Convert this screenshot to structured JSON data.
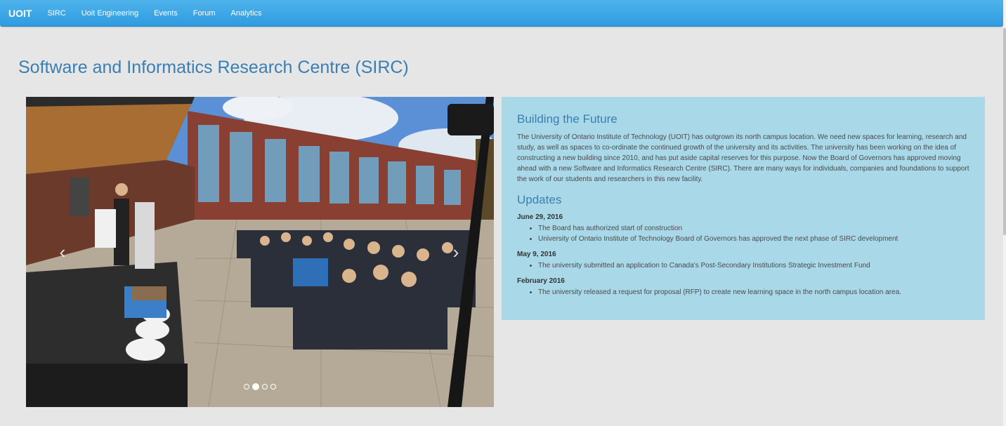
{
  "navbar": {
    "brand": "UOIT",
    "links": [
      "SIRC",
      "Uoit Engineering",
      "Events",
      "Forum",
      "Analytics"
    ]
  },
  "page": {
    "title": "Software and Informatics Research Centre (SIRC)"
  },
  "carousel": {
    "prev_icon": "chevron-left-icon",
    "next_icon": "chevron-right-icon",
    "prev_glyph": "‹",
    "next_glyph": "›",
    "slide_count": 4,
    "active_index": 1
  },
  "info": {
    "heading": "Building the Future",
    "intro": "The University of Ontario Institute of Technology (UOIT) has outgrown its north campus location. We need new spaces for learning, research and study, as well as spaces to co-ordinate the continued growth of the university and its activities. The university has been working on the idea of constructing a new building since 2010, and has put aside capital reserves for this purpose. Now the Board of Governors has approved moving ahead with a new Software and Informatics Research Centre (SIRC). There are many ways for individuals, companies and foundations to support the work of our students and researchers in this new facility.",
    "updates_heading": "Updates",
    "updates": [
      {
        "date": "June 29, 2016",
        "items": [
          "The Board has authorized start of construction",
          "University of Ontario Institute of Technology Board of Governors has approved the next phase of SIRC development"
        ]
      },
      {
        "date": "May 9, 2016",
        "items": [
          "The university submitted an application to Canada's Post-Secondary Institutions Strategic Investment Fund"
        ]
      },
      {
        "date": "February 2016",
        "items": [
          "The university released a request for proposal (RFP) to create new learning space in the north campus location area."
        ]
      }
    ]
  },
  "colors": {
    "navbar": "#3aa6e6",
    "title": "#3a7fb3",
    "panel": "#a9d9e8",
    "page_bg": "#e6e6e6"
  }
}
